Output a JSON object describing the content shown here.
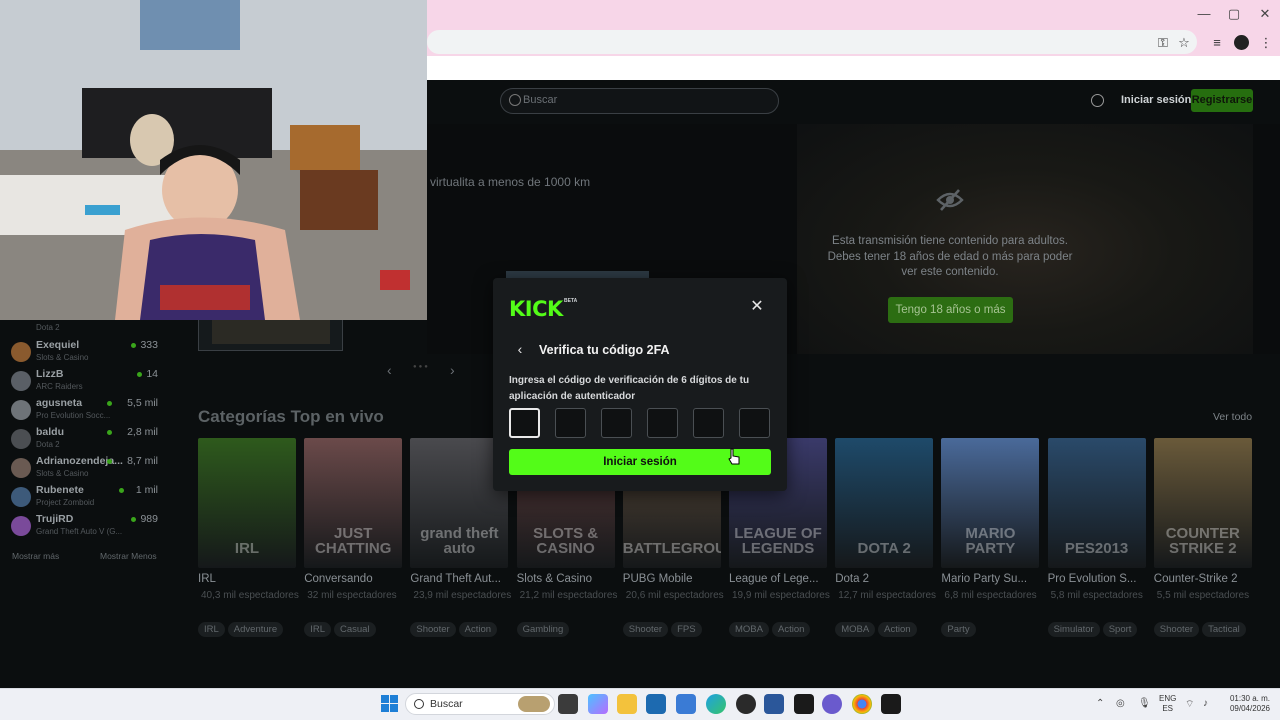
{
  "browser": {
    "window_controls": {
      "minimize": "—",
      "maximize": "▢",
      "close": "✕"
    }
  },
  "header": {
    "search_placeholder": "Buscar",
    "login_label": "Iniciar sesión",
    "signup_label": "Registrarse"
  },
  "featured": {
    "title_fragment": "virtualita a menos de 1000 km",
    "adult_notice": "Esta transmisión tiene contenido para adultos. Debes tener 18 años de edad o más para poder ver este contenido.",
    "adult_button": "Tengo 18 años o más"
  },
  "sidebar": {
    "top_game": "Dota 2",
    "channels": [
      {
        "name": "Exequiel",
        "game": "Slots & Casino",
        "viewers": "333",
        "color": "#8a5a2e"
      },
      {
        "name": "LizzB",
        "game": "ARC Raiders",
        "viewers": "14",
        "color": "#5a5f66"
      },
      {
        "name": "agusneta",
        "game": "Pro Evolution Socc...",
        "viewers": "5,5 mil",
        "color": "#6e7378"
      },
      {
        "name": "baldu",
        "game": "Dota 2",
        "viewers": "2,8 mil",
        "color": "#4b4e52"
      },
      {
        "name": "Adrianozendeja...",
        "game": "Slots & Casino",
        "viewers": "8,7 mil",
        "color": "#6a5a52"
      },
      {
        "name": "Rubenete",
        "game": "Project Zomboid",
        "viewers": "1 mil",
        "color": "#3d5a7a"
      },
      {
        "name": "TrujiRD",
        "game": "Grand Theft Auto V (G...",
        "viewers": "989",
        "color": "#7a4a9a"
      }
    ],
    "show_more": "Mostrar más",
    "show_less": "Mostrar Menos"
  },
  "categories": {
    "title": "Categorías Top en vivo",
    "see_all": "Ver todo",
    "items": [
      {
        "name": "IRL",
        "views": "40,3 mil espectadores",
        "tags": [
          "IRL",
          "Adventure"
        ],
        "img_text": "IRL",
        "bg": "#2e5a1c"
      },
      {
        "name": "Conversando",
        "views": "32 mil espectadores",
        "tags": [
          "IRL",
          "Casual"
        ],
        "img_text": "JUST CHATTING",
        "bg": "#6b4a4a"
      },
      {
        "name": "Grand Theft Aut...",
        "views": "23,9 mil espectadores",
        "tags": [
          "Shooter",
          "Action"
        ],
        "img_text": "grand theft auto",
        "bg": "#4a4a4e"
      },
      {
        "name": "Slots & Casino",
        "views": "21,2 mil espectadores",
        "tags": [
          "Gambling"
        ],
        "img_text": "SLOTS & CASINO",
        "bg": "#5a3a3a"
      },
      {
        "name": "PUBG Mobile",
        "views": "20,6 mil espectadores",
        "tags": [
          "Shooter",
          "FPS"
        ],
        "img_text": "BATTLEGROUNDS",
        "bg": "#5a4a3a"
      },
      {
        "name": "League of Lege...",
        "views": "19,9 mil espectadores",
        "tags": [
          "MOBA",
          "Action"
        ],
        "img_text": "LEAGUE OF LEGENDS",
        "bg": "#3a3a6a"
      },
      {
        "name": "Dota 2",
        "views": "12,7 mil espectadores",
        "tags": [
          "MOBA",
          "Action"
        ],
        "img_text": "DOTA 2",
        "bg": "#1e4a6a"
      },
      {
        "name": "Mario Party Su...",
        "views": "6,8 mil espectadores",
        "tags": [
          "Party"
        ],
        "img_text": "MARIO PARTY",
        "bg": "#4a6a9a"
      },
      {
        "name": "Pro Evolution S...",
        "views": "5,8 mil espectadores",
        "tags": [
          "Simulator",
          "Sport"
        ],
        "img_text": "PES2013",
        "bg": "#2a4a6a"
      },
      {
        "name": "Counter-Strike 2",
        "views": "5,5 mil espectadores",
        "tags": [
          "Shooter",
          "Tactical"
        ],
        "img_text": "COUNTER STRIKE 2",
        "bg": "#6a5a3a"
      }
    ]
  },
  "modal": {
    "logo": "KICK",
    "beta": "BETA",
    "close_icon": "✕",
    "back_icon": "‹",
    "title": "Verifica tu código 2FA",
    "description": "Ingresa el código de verificación de 6 dígitos de tu aplicación de autenticador",
    "code_length": 6,
    "submit_label": "Iniciar sesión",
    "accent": "#53fc18"
  },
  "taskbar": {
    "search_label": "Buscar",
    "lang_line1": "ENG",
    "lang_line2": "ES",
    "time": "01:30 a. m.",
    "date": "09/04/2026"
  }
}
